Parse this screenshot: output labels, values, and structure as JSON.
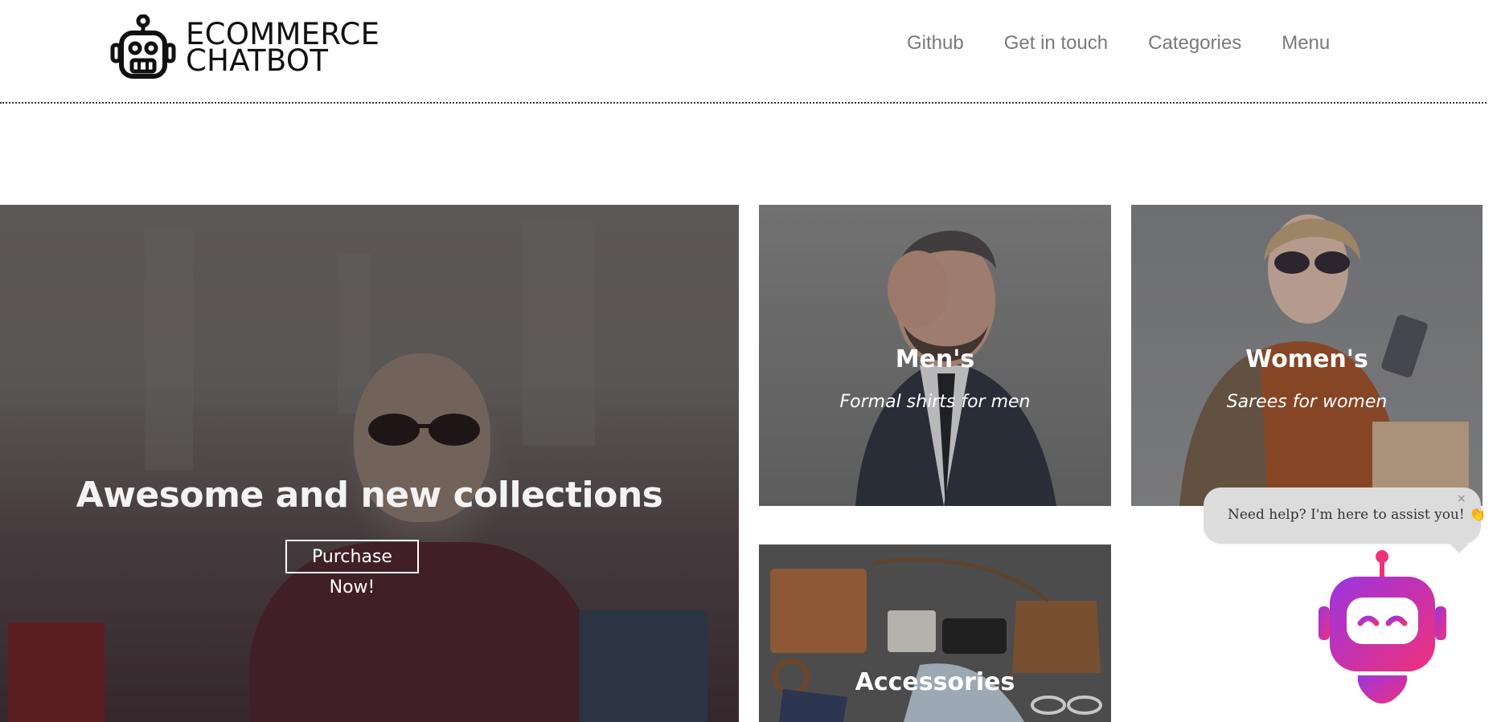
{
  "header": {
    "logo_line1": "ECOMMERCE",
    "logo_line2": "CHATBOT",
    "nav": [
      {
        "label": "Github"
      },
      {
        "label": "Get in touch"
      },
      {
        "label": "Categories"
      },
      {
        "label": "Menu"
      }
    ]
  },
  "hero": {
    "title": "Awesome and new collections",
    "button_label": "Purchase Now!"
  },
  "categories": [
    {
      "title": "Men's",
      "subtitle": "Formal shirts for men"
    },
    {
      "title": "Women's",
      "subtitle": "Sarees for women"
    },
    {
      "title": "Accessories"
    }
  ],
  "chat": {
    "message": "Need help? I'm here to assist you! 👏",
    "close_symbol": "×"
  },
  "colors": {
    "nav_text": "#7a7a7a",
    "bot_gradient_start": "#9b34e0",
    "bot_gradient_end": "#f0317a"
  }
}
